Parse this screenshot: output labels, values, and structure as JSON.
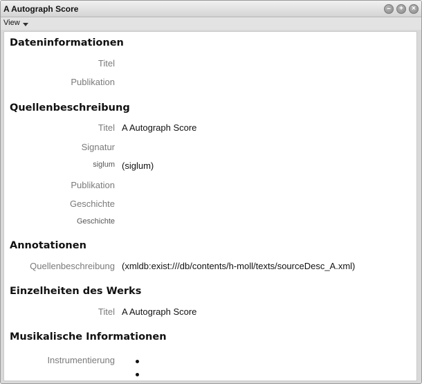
{
  "window": {
    "title": "A Autograph Score",
    "buttons": [
      "minimize",
      "maximize",
      "close"
    ]
  },
  "menu": {
    "view_label": "View"
  },
  "sections": {
    "file_info": {
      "heading": "Dateninformationen",
      "title_label": "Titel",
      "publication_label": "Publikation"
    },
    "source_desc": {
      "heading": "Quellenbeschreibung",
      "title_label": "Titel",
      "title_value": "A Autograph Score",
      "signature_label": "Signatur",
      "siglum_label": "siglum",
      "siglum_value": "(siglum)",
      "publication_label": "Publikation",
      "history_label": "Geschichte",
      "history_sub_label": "Geschichte"
    },
    "annotations": {
      "heading": "Annotationen",
      "source_desc_label": "Quellenbeschreibung",
      "source_desc_value": "(xmldb:exist:///db/contents/h-moll/texts/sourceDesc_A.xml)"
    },
    "work_details": {
      "heading": "Einzelheiten des Werks",
      "title_label": "Titel",
      "title_value": "A Autograph Score"
    },
    "music_info": {
      "heading": "Musikalische Informationen",
      "instrumentation_label": "Instrumentierung"
    }
  }
}
